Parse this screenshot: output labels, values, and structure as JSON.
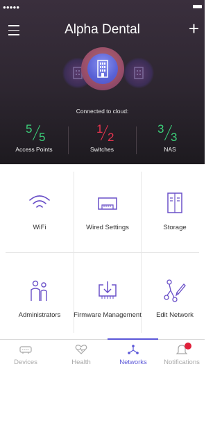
{
  "header": {
    "title": "Alpha Dental",
    "menu_icon": "hamburger-menu-icon",
    "add_icon": "plus-icon"
  },
  "status": {
    "cloud_label": "Connected to cloud:"
  },
  "stats": [
    {
      "label": "Access Points",
      "numerator": "5",
      "denominator": "5",
      "color": "#3ccf7a"
    },
    {
      "label": "Switches",
      "numerator": "1",
      "denominator": "2",
      "color": "#e8344f"
    },
    {
      "label": "NAS",
      "numerator": "3",
      "denominator": "3",
      "color": "#3ccf7a"
    }
  ],
  "tiles": [
    {
      "label": "WiFi",
      "icon": "wifi-icon"
    },
    {
      "label": "Wired Settings",
      "icon": "ethernet-port-icon"
    },
    {
      "label": "Storage",
      "icon": "storage-icon"
    },
    {
      "label": "Administrators",
      "icon": "administrators-icon"
    },
    {
      "label": "Firmware Management",
      "icon": "firmware-download-icon"
    },
    {
      "label": "Edit Network",
      "icon": "edit-network-icon"
    }
  ],
  "tabs": [
    {
      "label": "Devices",
      "icon": "devices-icon"
    },
    {
      "label": "Health",
      "icon": "health-heart-icon"
    },
    {
      "label": "Networks",
      "icon": "networks-icon",
      "active": true
    },
    {
      "label": "Notifications",
      "icon": "bell-icon",
      "badge": true
    }
  ],
  "colors": {
    "accent": "#5b57d8",
    "icon_purple": "#6a50c8",
    "ok_green": "#3ccf7a",
    "warn_red": "#e8344f"
  }
}
